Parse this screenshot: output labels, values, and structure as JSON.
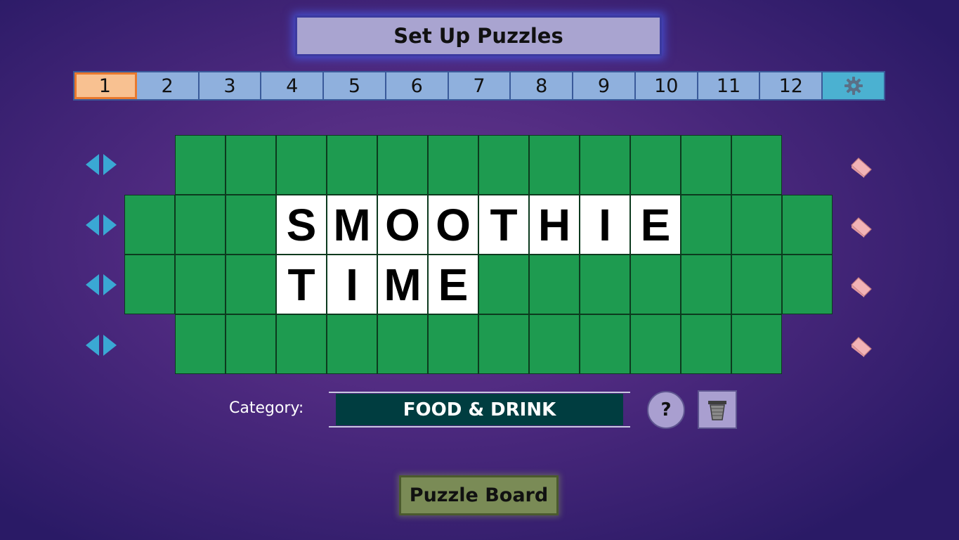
{
  "header": {
    "title": "Set Up Puzzles"
  },
  "tabs": {
    "items": [
      "1",
      "2",
      "3",
      "4",
      "5",
      "6",
      "7",
      "8",
      "9",
      "10",
      "11",
      "12"
    ],
    "active": "1",
    "settings_icon": "gear-icon"
  },
  "board": {
    "rows": [
      [
        "",
        "",
        "",
        "",
        "",
        "",
        "",
        "",
        "",
        "",
        "",
        ""
      ],
      [
        "",
        "",
        "",
        "S",
        "M",
        "O",
        "O",
        "T",
        "H",
        "I",
        "E",
        "",
        "",
        ""
      ],
      [
        "",
        "",
        "",
        "T",
        "I",
        "M",
        "E",
        "",
        "",
        "",
        "",
        "",
        "",
        ""
      ],
      [
        "",
        "",
        "",
        "",
        "",
        "",
        "",
        "",
        "",
        "",
        "",
        ""
      ]
    ],
    "row_controls": {
      "shift_icon": "left-right-arrows-icon",
      "clear_icon": "eraser-icon"
    },
    "colors": {
      "empty_tile": "#1e9b50",
      "letter_tile": "#ffffff"
    }
  },
  "category": {
    "label": "Category:",
    "value": "FOOD & DRINK"
  },
  "buttons": {
    "help_label": "?",
    "trash_icon": "trash-bin-icon",
    "puzzle_board_label": "Puzzle Board"
  }
}
